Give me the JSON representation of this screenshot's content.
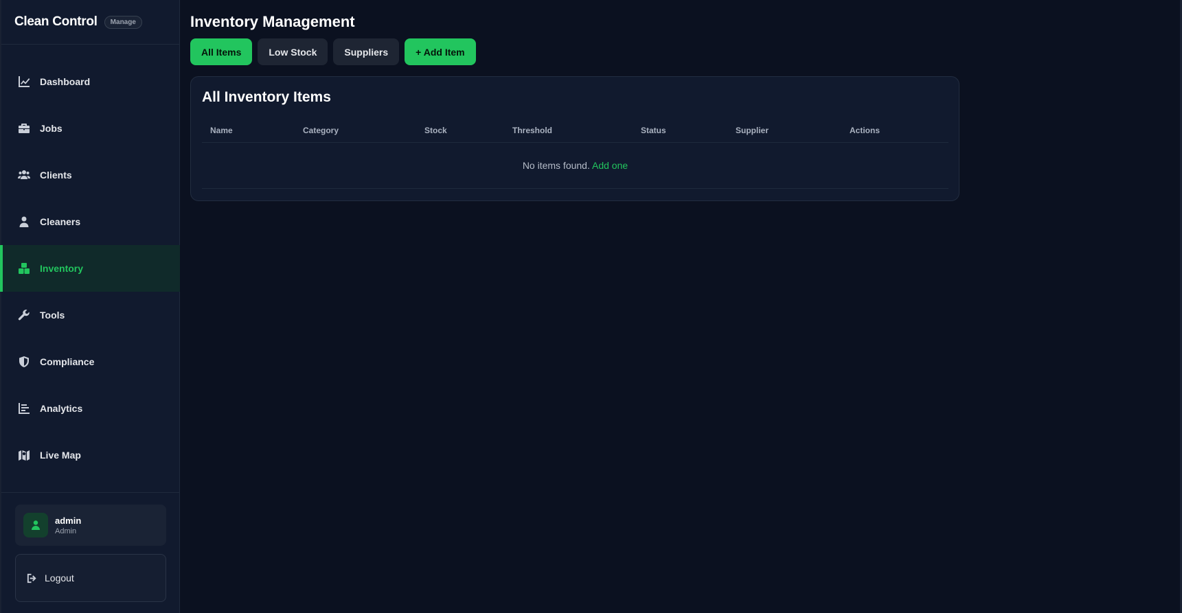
{
  "brand": {
    "name": "Clean Control",
    "badge": "Manage"
  },
  "nav": [
    {
      "label": "Dashboard",
      "icon": "chart-line-icon"
    },
    {
      "label": "Jobs",
      "icon": "briefcase-icon"
    },
    {
      "label": "Clients",
      "icon": "users-icon"
    },
    {
      "label": "Cleaners",
      "icon": "user-tie-icon"
    },
    {
      "label": "Inventory",
      "icon": "boxes-icon",
      "active": true
    },
    {
      "label": "Tools",
      "icon": "wrench-icon"
    },
    {
      "label": "Compliance",
      "icon": "shield-icon"
    },
    {
      "label": "Analytics",
      "icon": "bar-chart-icon"
    },
    {
      "label": "Live Map",
      "icon": "map-icon"
    }
  ],
  "user": {
    "name": "admin",
    "role": "Admin"
  },
  "logout_label": "Logout",
  "main": {
    "title": "Inventory Management",
    "tabs": [
      "All Items",
      "Low Stock",
      "Suppliers",
      "+ Add Item"
    ],
    "card_title": "All Inventory Items",
    "columns": [
      "Name",
      "Category",
      "Stock",
      "Threshold",
      "Status",
      "Supplier",
      "Actions"
    ],
    "empty_text": "No items found.",
    "empty_link": "Add one"
  },
  "colors": {
    "accent": "#22c55e",
    "background": "#0b1120",
    "sidebar": "#111a2e"
  }
}
